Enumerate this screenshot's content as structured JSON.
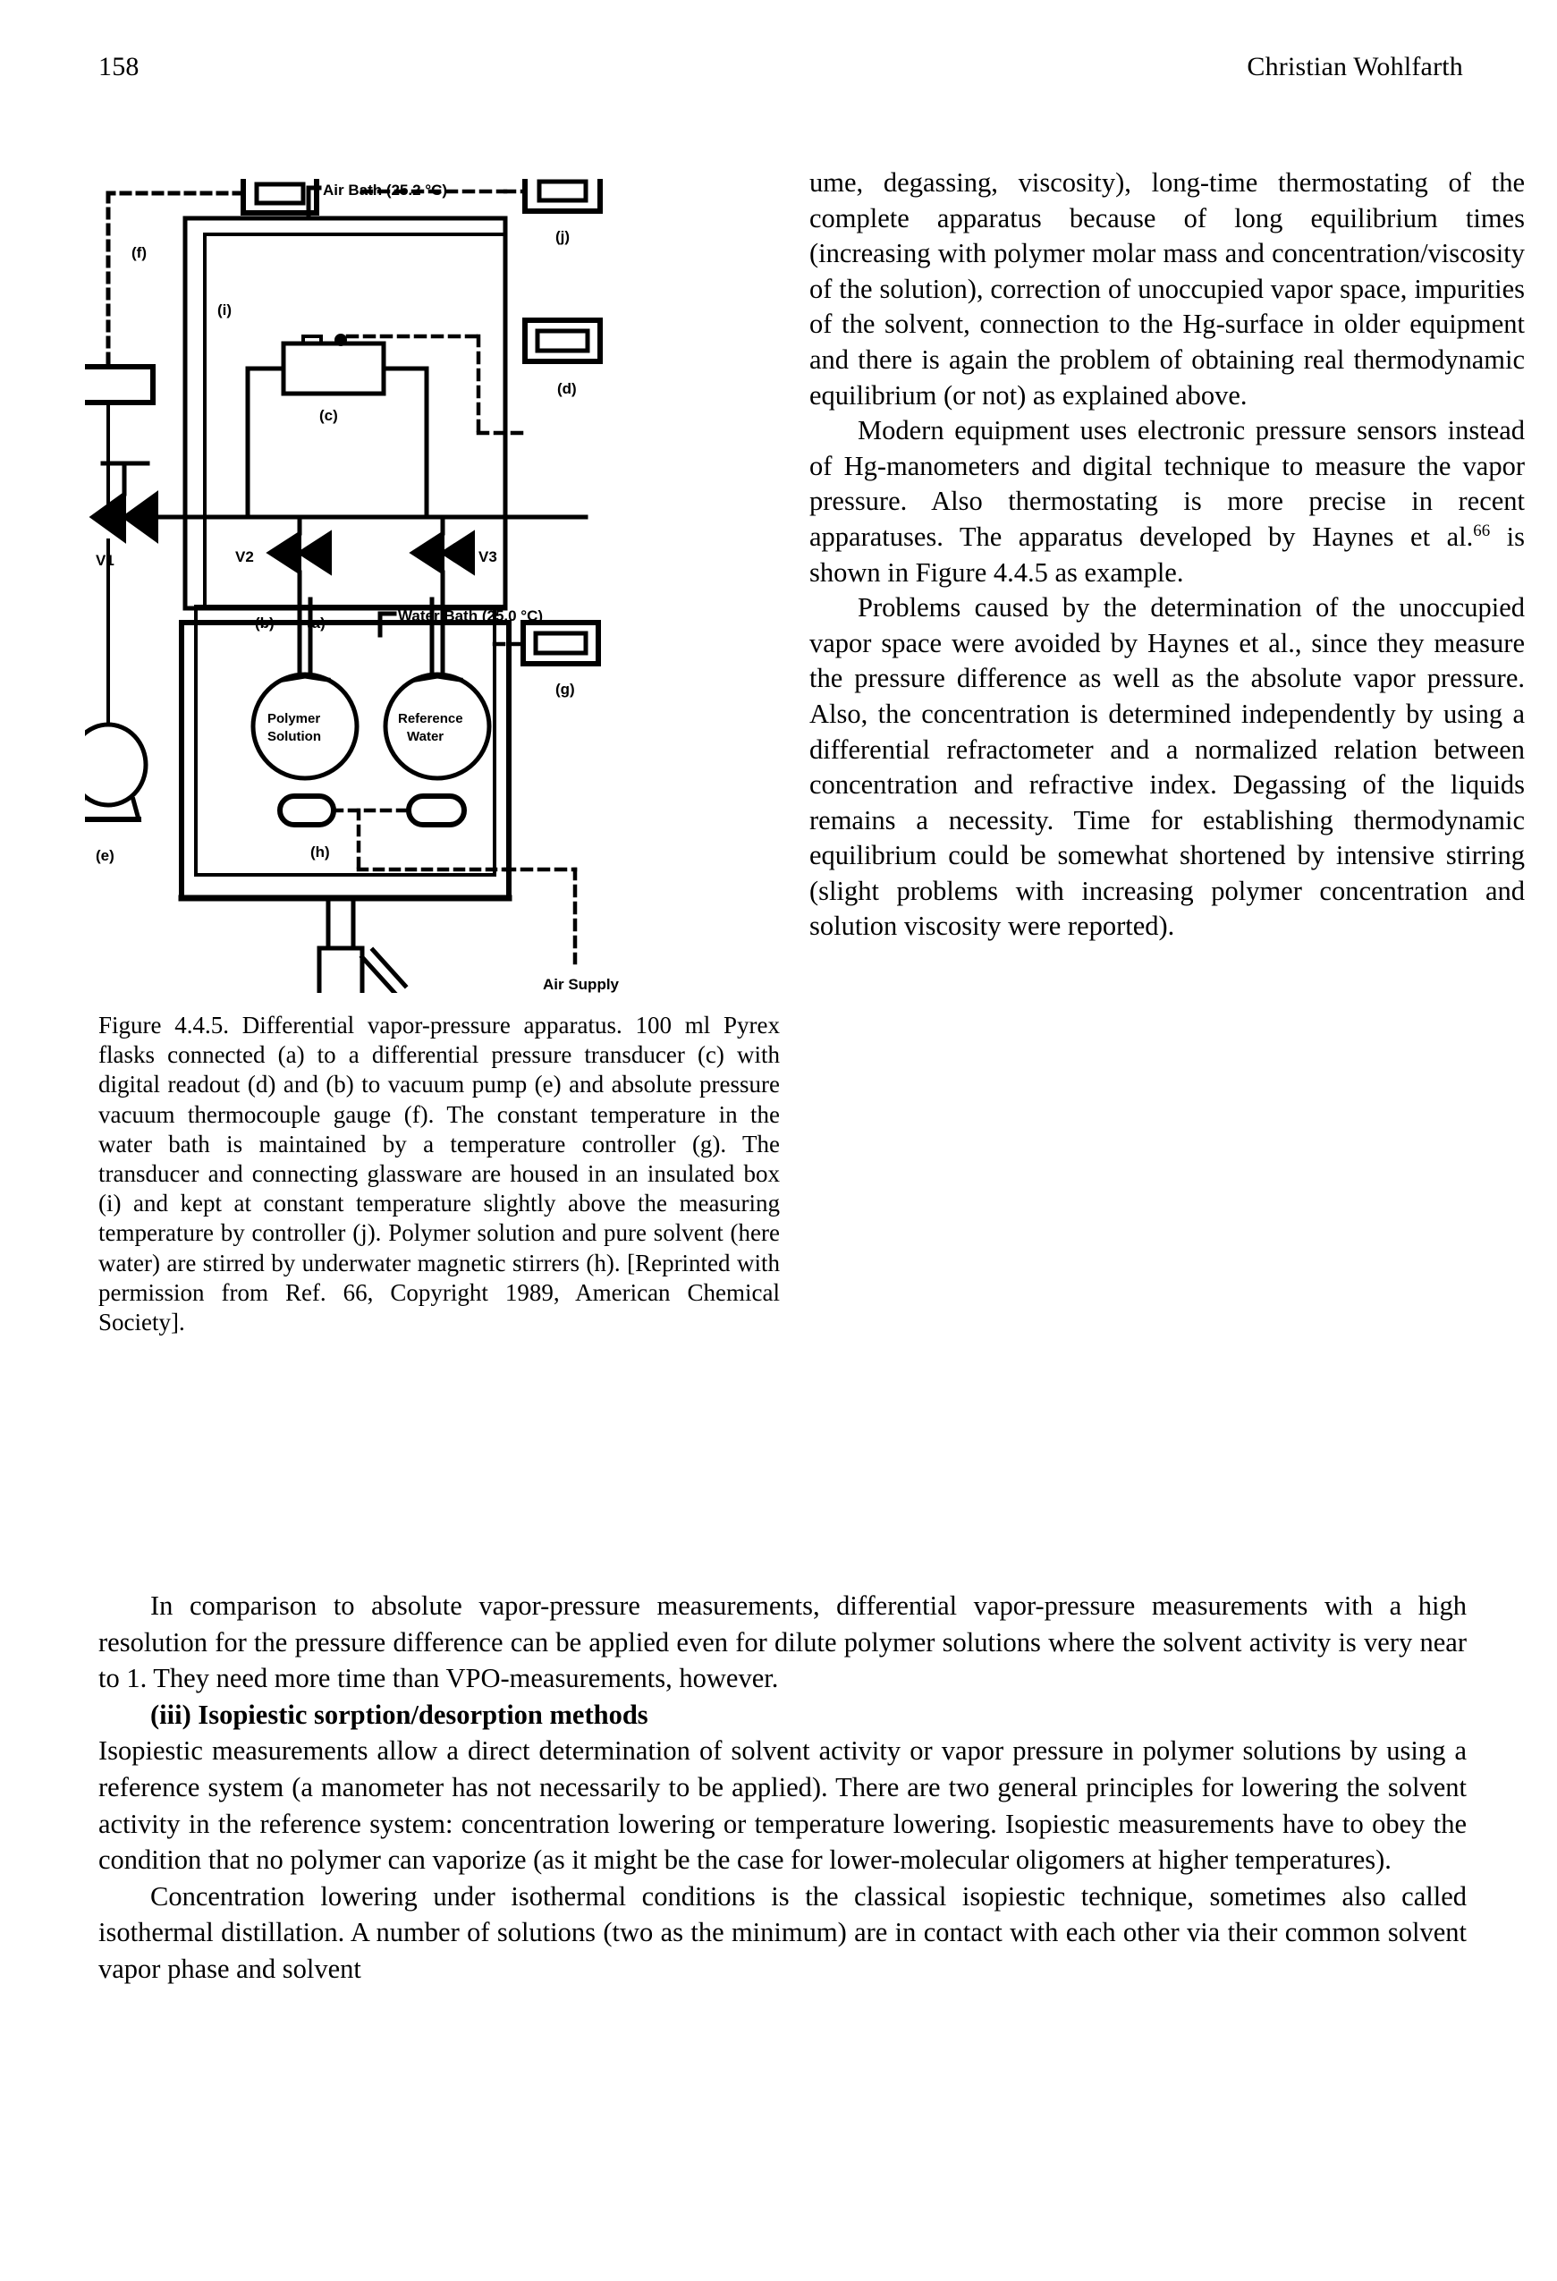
{
  "header": {
    "folio": "158",
    "author": "Christian Wohlfarth"
  },
  "right_column": {
    "paragraphs": [
      "ume, degassing, viscosity), long-time thermostating of the complete apparatus because of long equilibrium times (increasing with polymer molar mass and concentration/viscosity of the solution), correction of unoccupied vapor space, impurities of the solvent, connection to the Hg-surface in older equipment and there is again the problem of obtaining real thermodynamic equilibrium (or not) as explained above.",
      "Modern equipment uses electronic pressure sensors instead of Hg-manometers and digital technique to measure the vapor pressure. Also thermostating is more precise in recent apparatuses. The apparatus developed by Haynes et al.",
      "Problems caused by the determination of the unoccupied vapor space were avoided by Haynes et al., since they measure the pressure difference as well as the absolute vapor pressure. Also, the concentration is determined independently by using a differential refractometer and a normalized relation between concentration and refractive index. Degassing of the liquids remains a necessity. Time for establishing thermodynamic equilibrium could be somewhat shortened by intensive stirring (slight problems with increasing polymer concentration and solution viscosity were reported)."
    ],
    "haynes_ref_superscript": "66",
    "haynes_tail": " is shown in Figure 4.4.5 as example."
  },
  "figure": {
    "caption": "Figure 4.4.5. Differential vapor-pressure apparatus. 100 ml Pyrex flasks connected (a) to a differential pressure transducer (c) with digital readout (d) and (b) to vacuum pump (e) and absolute pressure vacuum thermocouple gauge (f). The constant temperature in the water bath is maintained by a temperature controller (g). The transducer and connecting glassware are housed in an insulated box (i) and kept at constant temperature slightly above the measuring temperature by controller (j). Polymer solution and pure solvent (here water) are stirred by underwater magnetic stirrers (h). [Reprinted with permission from Ref. 66, Copyright 1989, American Chemical Society].",
    "labels": {
      "air_bath": "Air Bath (25.2 °C)",
      "water_bath": "Water Bath (25.0 °C)",
      "air_supply": "Air Supply",
      "flask_left_line1": "Polymer",
      "flask_left_line2": "Solution",
      "flask_right_line1": "Reference",
      "flask_right_line2": "Water",
      "valve_v1": "V1",
      "valve_v2": "V2",
      "valve_v3": "V3",
      "item_a": "(a)",
      "item_b": "(b)",
      "item_c": "(c)",
      "item_d": "(d)",
      "item_e": "(e)",
      "item_f": "(f)",
      "item_g": "(g)",
      "item_h": "(h)",
      "item_i": "(i)",
      "item_j": "(j)"
    }
  },
  "bottom_block": {
    "paragraph_1": "In comparison to absolute vapor-pressure measurements, differential vapor-pressure measurements with a high resolution for the pressure difference can be applied even for dilute polymer solutions where the solvent activity is very near to 1. They need more time than VPO-measurements, however.",
    "subheading": "(iii) Isopiestic sorption/desorption methods",
    "paragraph_2": "Isopiestic measurements allow a direct determination of solvent activity or vapor pressure in polymer solutions by using a reference system (a manometer has not necessarily to be applied). There are two general principles for lowering the solvent activity in the reference system: concentration lowering or temperature lowering. Isopiestic measurements have to obey the condition that no polymer can vaporize (as it might be the case for lower-molecular oligomers at higher temperatures).",
    "paragraph_3": "Concentration lowering under isothermal conditions is the classical isopiestic technique, sometimes also called isothermal distillation. A number of solutions (two as the minimum) are in contact with each other via their common solvent vapor phase and solvent"
  }
}
